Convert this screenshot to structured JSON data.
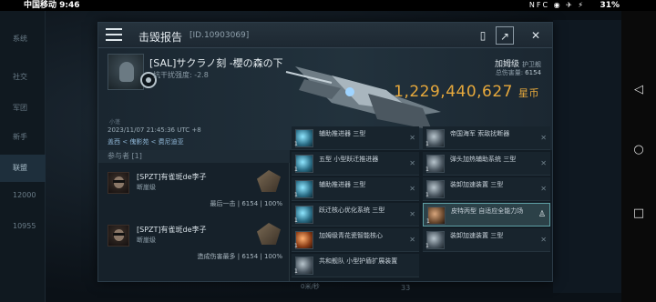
{
  "status_bar": {
    "carrier_time": "中国移动 9:46",
    "icons": "NFC ◉ ✈ ⚡",
    "battery": "31%"
  },
  "side_menu": {
    "items": [
      "系统",
      "社交",
      "军团",
      "新手",
      "联盟",
      "12000",
      "10955"
    ]
  },
  "background": {
    "speed": "0米/秒",
    "count": "33"
  },
  "dialog": {
    "title": "击毁报告",
    "report_id": "[ID.10903069]",
    "victim": {
      "name": "[SAL]サクラノ刻 -櫻の森の下",
      "security_label": "抗干扰强度: -2.8",
      "corp_label": "小蓬",
      "time": "2023/11/07 21:45:36 UTC +8",
      "location": "盖西 < 傀影苑 < 费尼迪亚"
    },
    "ship_class": "加姆级",
    "ship_role": "护卫舰",
    "total_mass_label": "总伤害量:",
    "total_mass_value": "6154",
    "isk_value": "1,229,440,627",
    "isk_unit": "星币",
    "kill_type": "击毁",
    "attackers_header": "参与者 [1]",
    "attackers": [
      {
        "name": "[SPZT]有雀斑de李子",
        "ship": "断崖级",
        "stats": "最后一击 | 6154 | 100%"
      },
      {
        "name": "[SPZT]有雀斑de李子",
        "ship": "断崖级",
        "stats": "造成伤害最多 | 6154 | 100%"
      }
    ],
    "items_left": [
      {
        "label": "辅助推进器 三型",
        "qty": "1",
        "icon": "cyan"
      },
      {
        "label": "五型 小型跃迁推进器",
        "qty": "1",
        "icon": "cyan"
      },
      {
        "label": "辅助推进器 三型",
        "qty": "1",
        "icon": "cyan"
      },
      {
        "label": "跃迁核心优化系统 三型",
        "qty": "1",
        "icon": "cyan"
      },
      {
        "label": "加姆级青花瓷智能核心",
        "qty": "1",
        "icon": "orange"
      },
      {
        "label": "共和舰队 小型护盾扩展装置",
        "qty": "1",
        "icon": "gray"
      }
    ],
    "items_right": [
      {
        "label": "帝国海军 索敌扰断器",
        "qty": "1",
        "icon": "gray"
      },
      {
        "label": "弹头加热辅助系统 三型",
        "qty": "1",
        "icon": "gray"
      },
      {
        "label": "装卸加速装置 三型",
        "qty": "1",
        "icon": "gray"
      },
      {
        "label": "皮特丙型 自适应全能力场",
        "qty": "1",
        "icon": "bronze"
      },
      {
        "label": "装卸加速装置 三型",
        "qty": "1",
        "icon": "gray"
      }
    ],
    "remove_glyph": "✕",
    "fit_glyph": "♙"
  }
}
